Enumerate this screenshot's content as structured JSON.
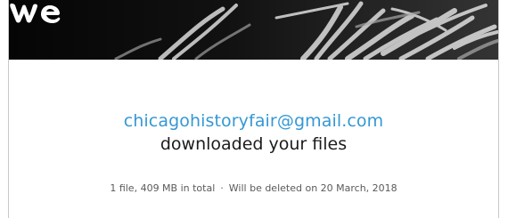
{
  "recipient_email": "chicagohistoryfair@gmail.com",
  "headline": "downloaded your files",
  "file_summary": "1 file, 409 MB in total",
  "separator": "·",
  "expiry_note": "Will be deleted on 20 March, 2018",
  "icons": {
    "logo": "wetransfer-logo-icon",
    "banner": "hands-photo-banner"
  },
  "colors": {
    "banner_bg": "#050505",
    "email": "#3598d4",
    "headline": "#1c1c1c",
    "meta": "#5a5a5a"
  }
}
